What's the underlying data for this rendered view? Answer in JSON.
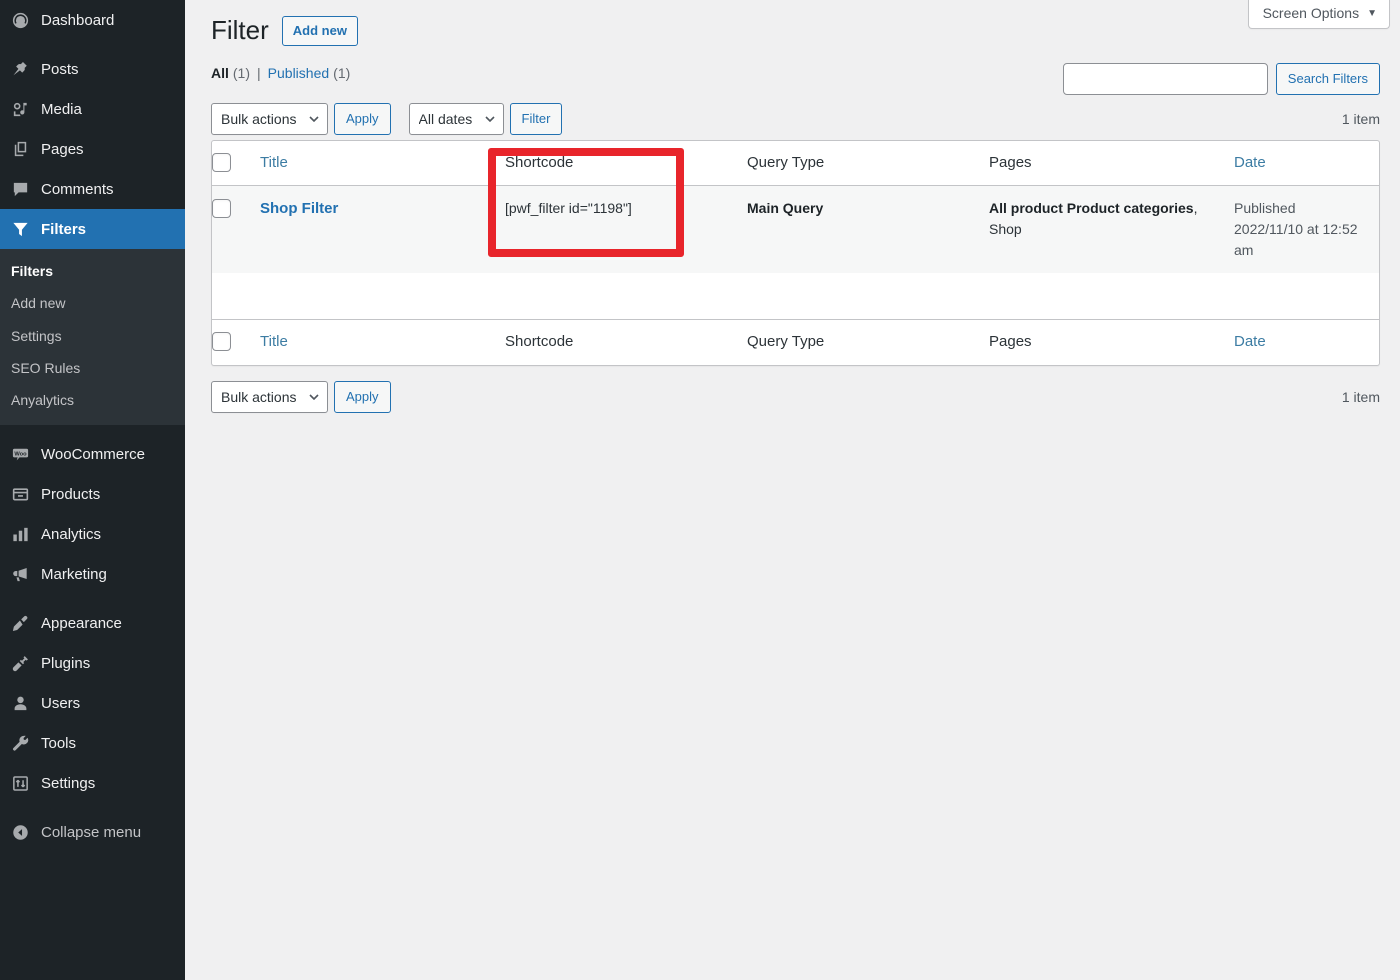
{
  "sidebar": {
    "items": [
      {
        "label": "Dashboard",
        "icon": "dashboard-icon",
        "name": "sidebar-item-dashboard"
      },
      {
        "label": "Posts",
        "icon": "pin-icon",
        "name": "sidebar-item-posts"
      },
      {
        "label": "Media",
        "icon": "media-icon",
        "name": "sidebar-item-media"
      },
      {
        "label": "Pages",
        "icon": "pages-icon",
        "name": "sidebar-item-pages"
      },
      {
        "label": "Comments",
        "icon": "comment-icon",
        "name": "sidebar-item-comments"
      },
      {
        "label": "Filters",
        "icon": "funnel-icon",
        "name": "sidebar-item-filters",
        "active": true
      },
      {
        "label": "WooCommerce",
        "icon": "woocommerce-icon",
        "name": "sidebar-item-woocommerce"
      },
      {
        "label": "Products",
        "icon": "products-icon",
        "name": "sidebar-item-products"
      },
      {
        "label": "Analytics",
        "icon": "bar-chart-icon",
        "name": "sidebar-item-analytics"
      },
      {
        "label": "Marketing",
        "icon": "megaphone-icon",
        "name": "sidebar-item-marketing"
      },
      {
        "label": "Appearance",
        "icon": "paintbrush-icon",
        "name": "sidebar-item-appearance"
      },
      {
        "label": "Plugins",
        "icon": "plug-icon",
        "name": "sidebar-item-plugins"
      },
      {
        "label": "Users",
        "icon": "user-icon",
        "name": "sidebar-item-users"
      },
      {
        "label": "Tools",
        "icon": "wrench-icon",
        "name": "sidebar-item-tools"
      },
      {
        "label": "Settings",
        "icon": "sliders-icon",
        "name": "sidebar-item-settings"
      }
    ],
    "submenu": [
      {
        "label": "Filters",
        "current": true
      },
      {
        "label": "Add new",
        "current": false
      },
      {
        "label": "Settings",
        "current": false
      },
      {
        "label": "SEO Rules",
        "current": false
      },
      {
        "label": "Anyalytics",
        "current": false
      }
    ],
    "collapse_label": "Collapse menu",
    "active_color": "#2271b1",
    "background": "#1d2327",
    "submenu_background": "#2c3338"
  },
  "screen_options": {
    "label": "Screen Options",
    "caret": "▼"
  },
  "header": {
    "title": "Filter",
    "add_new_label": "Add new"
  },
  "views": [
    {
      "label": "All",
      "count": "(1)",
      "current": true
    },
    {
      "label": "Published",
      "count": "(1)",
      "current": false
    }
  ],
  "view_separator": "|",
  "search": {
    "value": "",
    "placeholder": "",
    "button_label": "Search Filters"
  },
  "tablenav_top": {
    "bulk_label": "Bulk actions",
    "apply_label": "Apply",
    "dates_label": "All dates",
    "filter_label": "Filter",
    "count_label": "1 item"
  },
  "tablenav_bottom": {
    "bulk_label": "Bulk actions",
    "apply_label": "Apply",
    "count_label": "1 item"
  },
  "table": {
    "columns": [
      {
        "key": "title",
        "label": "Title",
        "sortable": true
      },
      {
        "key": "shortcode",
        "label": "Shortcode",
        "sortable": false
      },
      {
        "key": "query_type",
        "label": "Query Type",
        "sortable": false
      },
      {
        "key": "pages",
        "label": "Pages",
        "sortable": false
      },
      {
        "key": "date",
        "label": "Date",
        "sortable": true
      }
    ],
    "rows": [
      {
        "title": "Shop Filter",
        "shortcode": "[pwf_filter id=\"1198\"]",
        "query_type": "Main Query",
        "pages_bold": "All product Product categories",
        "pages_rest": ", Shop",
        "date_status": "Published",
        "date_value": "2022/11/10 at 12:52 am"
      }
    ]
  },
  "annotation": {
    "highlight_color": "#e8252b",
    "highlight_target": "shortcode-column"
  }
}
